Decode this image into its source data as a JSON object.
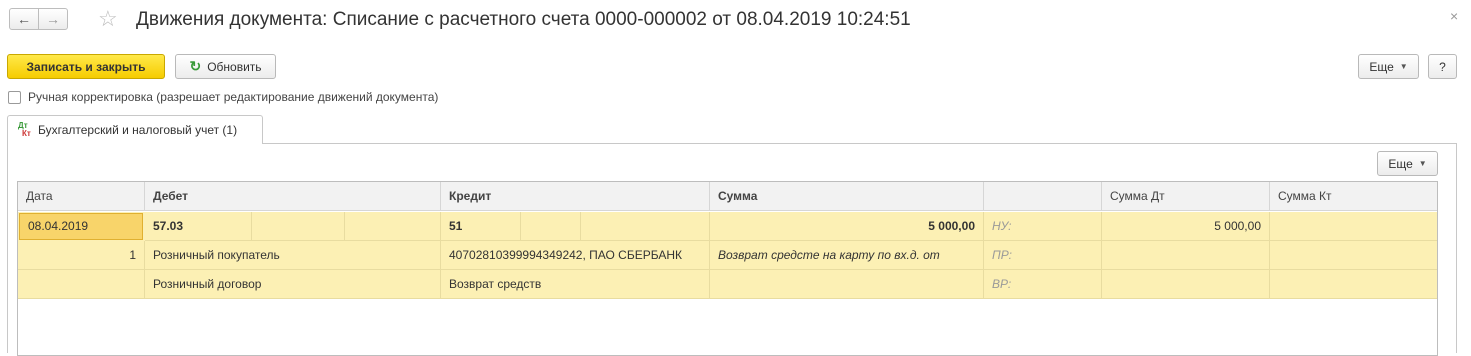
{
  "window": {
    "title": "Движения документа: Списание с расчетного счета 0000-000002 от 08.04.2019 10:24:51",
    "back_icon": "←",
    "forward_icon": "→",
    "star_icon": "☆",
    "close_icon": "×"
  },
  "toolbar": {
    "save_close_label": "Записать и закрыть",
    "refresh_label": "Обновить",
    "refresh_icon": "↻",
    "more_label": "Еще",
    "help_label": "?"
  },
  "manual_edit": {
    "label": "Ручная корректировка (разрешает редактирование движений документа)",
    "checked": false
  },
  "tab": {
    "label": "Бухгалтерский и налоговый учет (1)",
    "icon_top": "Дт",
    "icon_bottom": "Кт"
  },
  "panel": {
    "more_label": "Еще"
  },
  "table": {
    "columns": [
      "Дата",
      "Дебет",
      "Кредит",
      "Сумма",
      "",
      "Сумма Дт",
      "Сумма Кт"
    ],
    "row": {
      "date": "08.04.2019",
      "number": "1",
      "debit_account": "57.03",
      "debit_sub1": "Розничный покупатель",
      "debit_sub2": "Розничный договор",
      "credit_account": "51",
      "credit_sub1": "40702810399994349242, ПАО СБЕРБАНК",
      "credit_sub2": "Возврат средств",
      "amount": "5 000,00",
      "content": "Возврат средсте на карту по вх.д.  от",
      "nu_label": "НУ:",
      "pr_label": "ПР:",
      "vr_label": "ВР:",
      "amount_dt": "5 000,00",
      "amount_kt": ""
    }
  },
  "colors": {
    "accent_yellow": "#f6cc00",
    "row_highlight": "#fcf0b4",
    "refresh_green": "#3a9a3a"
  }
}
